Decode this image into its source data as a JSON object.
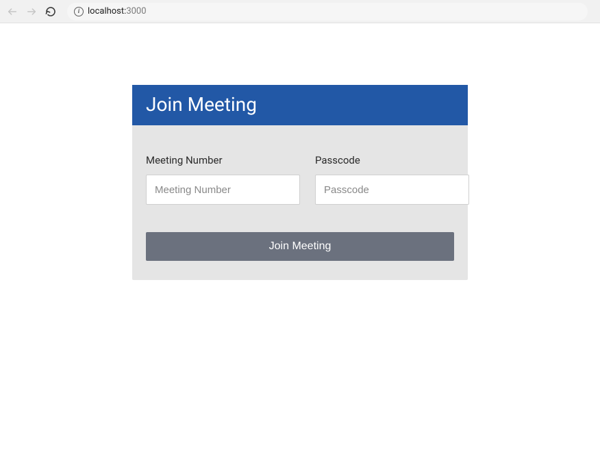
{
  "browser": {
    "url_host": "localhost:",
    "url_port": "3000"
  },
  "card": {
    "title": "Join Meeting"
  },
  "form": {
    "meeting_number": {
      "label": "Meeting Number",
      "placeholder": "Meeting Number",
      "value": ""
    },
    "passcode": {
      "label": "Passcode",
      "placeholder": "Passcode",
      "value": ""
    },
    "join_button_label": "Join Meeting"
  }
}
